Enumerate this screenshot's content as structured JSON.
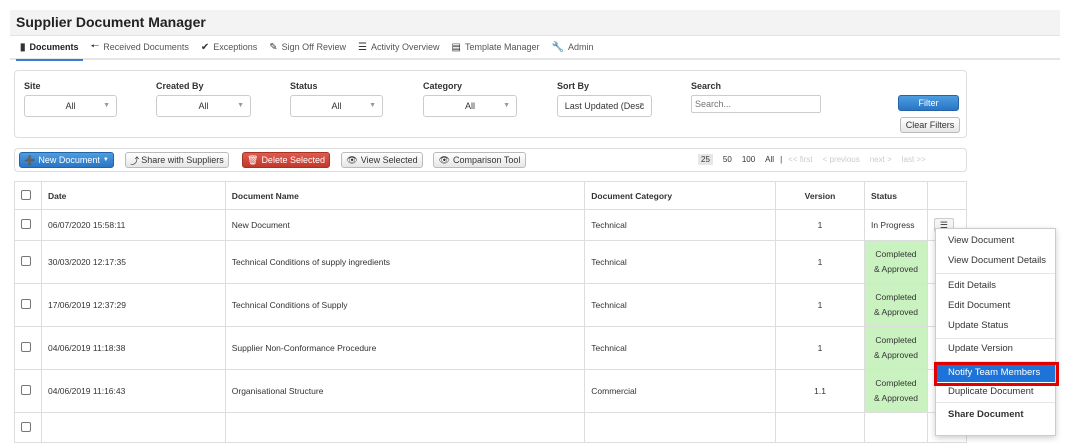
{
  "app": {
    "title": "Supplier Document Manager"
  },
  "nav": {
    "items": [
      {
        "label": "Documents",
        "icon": "file-icon"
      },
      {
        "label": "Received Documents",
        "icon": "arrow-left-icon"
      },
      {
        "label": "Exceptions",
        "icon": "circle-check-icon"
      },
      {
        "label": "Sign Off Review",
        "icon": "edit-check-icon"
      },
      {
        "label": "Activity Overview",
        "icon": "list-icon"
      },
      {
        "label": "Template Manager",
        "icon": "document-icon"
      },
      {
        "label": "Admin",
        "icon": "wrench-icon"
      }
    ]
  },
  "filters": {
    "site": {
      "label": "Site",
      "value": "All"
    },
    "created_by": {
      "label": "Created By",
      "value": "All"
    },
    "status": {
      "label": "Status",
      "value": "All"
    },
    "category": {
      "label": "Category",
      "value": "All"
    },
    "sort_by": {
      "label": "Sort By",
      "value": "Last Updated (Desc"
    },
    "search": {
      "label": "Search",
      "placeholder": "Search..."
    },
    "filter_button": "Filter",
    "clear_button": "Clear Filters"
  },
  "toolbar": {
    "new_document": "New Document",
    "share": "Share with Suppliers",
    "delete": "Delete Selected",
    "view_selected": "View Selected",
    "comparison": "Comparison Tool"
  },
  "pager": {
    "sizes": [
      "25",
      "50",
      "100",
      "All"
    ],
    "separator": "|",
    "first": "<< first",
    "previous": "< previous",
    "next": "next >",
    "last": "last >>"
  },
  "table": {
    "headers": {
      "date": "Date",
      "name": "Document Name",
      "category": "Document Category",
      "version": "Version",
      "status": "Status"
    },
    "rows": [
      {
        "date": "06/07/2020 15:58:11",
        "name": "New Document",
        "category": "Technical",
        "version": "1",
        "status": "In Progress"
      },
      {
        "date": "30/03/2020 12:17:35",
        "name": "Technical Conditions of supply ingredients",
        "category": "Technical",
        "version": "1",
        "status1": "Completed",
        "status2": "& Approved"
      },
      {
        "date": "17/06/2019 12:37:29",
        "name": "Technical Conditions of Supply",
        "category": "Technical",
        "version": "1",
        "status1": "Completed",
        "status2": "& Approved"
      },
      {
        "date": "04/06/2019 11:18:38",
        "name": "Supplier Non-Conformance Procedure",
        "category": "Technical",
        "version": "1",
        "status1": "Completed",
        "status2": "& Approved"
      },
      {
        "date": "04/06/2019 11:16:43",
        "name": "Organisational Structure",
        "category": "Commercial",
        "version": "1.1",
        "status1": "Completed",
        "status2": "& Approved"
      }
    ]
  },
  "menu": {
    "items": [
      "View Document",
      "View Document Details",
      "Edit Details",
      "Edit Document",
      "Update Status",
      "Update Version",
      "Notify Team Members",
      "Duplicate Document",
      "Share Document"
    ]
  },
  "colors": {
    "accent": "#2a75c5",
    "danger": "#c0392b",
    "approved": "#c9f2c0",
    "highlight": "#1e73d8",
    "annotation": "#e00000"
  }
}
